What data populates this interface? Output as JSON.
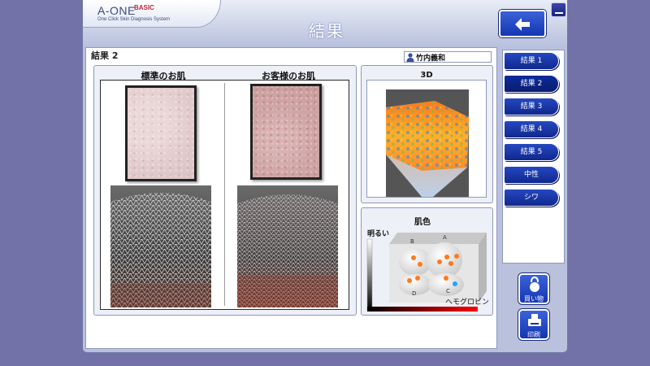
{
  "app": {
    "logo_main": "A-ONE",
    "logo_badge": "BASIC",
    "logo_sub": "One Click Skin Diagnosis System",
    "title": "結果"
  },
  "header": {
    "back_icon": "arrow-left-icon",
    "minimize_icon": "minimize-icon"
  },
  "content": {
    "label": "結果 2",
    "user_name": "竹内義和",
    "user_icon": "person-icon"
  },
  "comparison": {
    "standard_title": "標準のお肌",
    "customer_title": "お客様のお肌"
  },
  "view3d": {
    "title": "3D"
  },
  "skin_color": {
    "title": "肌色",
    "y_label": "明るい",
    "x_label": "ヘモグロビン",
    "groups": [
      "A",
      "B",
      "C",
      "D"
    ]
  },
  "sidebar": {
    "tabs": [
      {
        "label": "結果 1",
        "active": false
      },
      {
        "label": "結果 2",
        "active": true
      },
      {
        "label": "結果 3",
        "active": false
      },
      {
        "label": "結果 4",
        "active": false
      },
      {
        "label": "結果 5",
        "active": false
      },
      {
        "label": "中性",
        "active": false
      },
      {
        "label": "シワ",
        "active": false
      }
    ],
    "shop_label": "買い物",
    "print_label": "印刷"
  },
  "colors": {
    "accent_blue": "#1336b4",
    "background": "#7272a8",
    "window": "#b9c1dc",
    "hemoglobin_bar": "#e00000"
  }
}
